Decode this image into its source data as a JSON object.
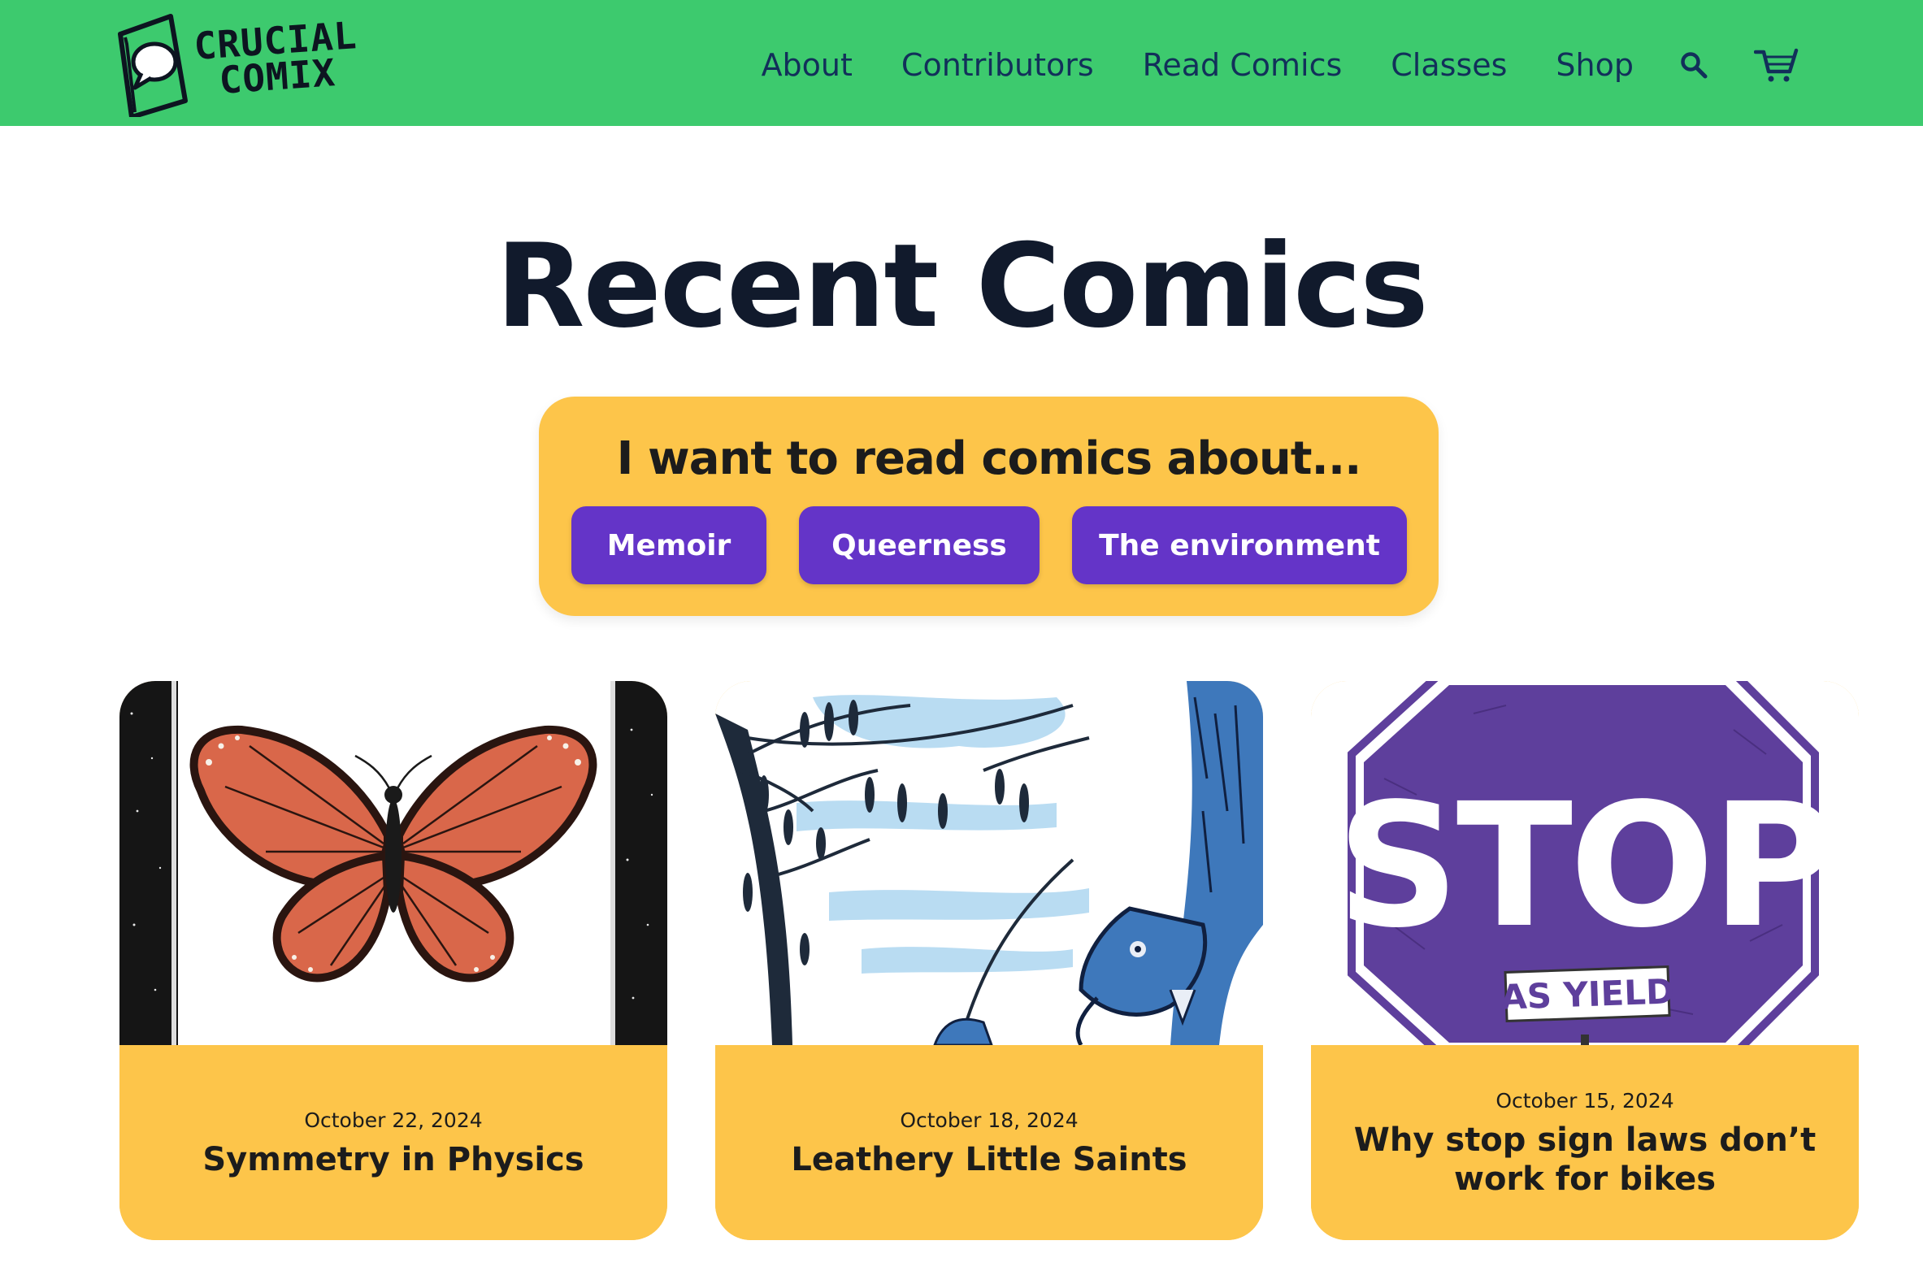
{
  "brand": {
    "name_line1": "CRUCIAL",
    "name_line2": "COMIX"
  },
  "nav": {
    "items": [
      "About",
      "Contributors",
      "Read Comics",
      "Classes",
      "Shop"
    ],
    "icons": [
      "search-icon",
      "cart-icon"
    ]
  },
  "page": {
    "title": "Recent Comics"
  },
  "topics": {
    "heading": "I want to read comics about...",
    "chips": [
      "Memoir",
      "Queerness",
      "The environment"
    ]
  },
  "cards": [
    {
      "date": "October 22, 2024",
      "title": "Symmetry in Physics",
      "image": "monarch-butterfly-illustration"
    },
    {
      "date": "October 18, 2024",
      "title": "Leathery Little Saints",
      "image": "hanging-bat-tree-illustration"
    },
    {
      "date": "October 15, 2024",
      "title": "Why stop sign laws don’t work for bikes",
      "image": "stop-sign-illustration",
      "sign_text": "STOP",
      "sign_sub": "AS YIELD"
    }
  ],
  "colors": {
    "header": "#3dca6e",
    "accent_yellow": "#fdc54a",
    "chip_purple": "#6434c8",
    "text_dark": "#111a2c",
    "nav_text": "#12305a"
  }
}
